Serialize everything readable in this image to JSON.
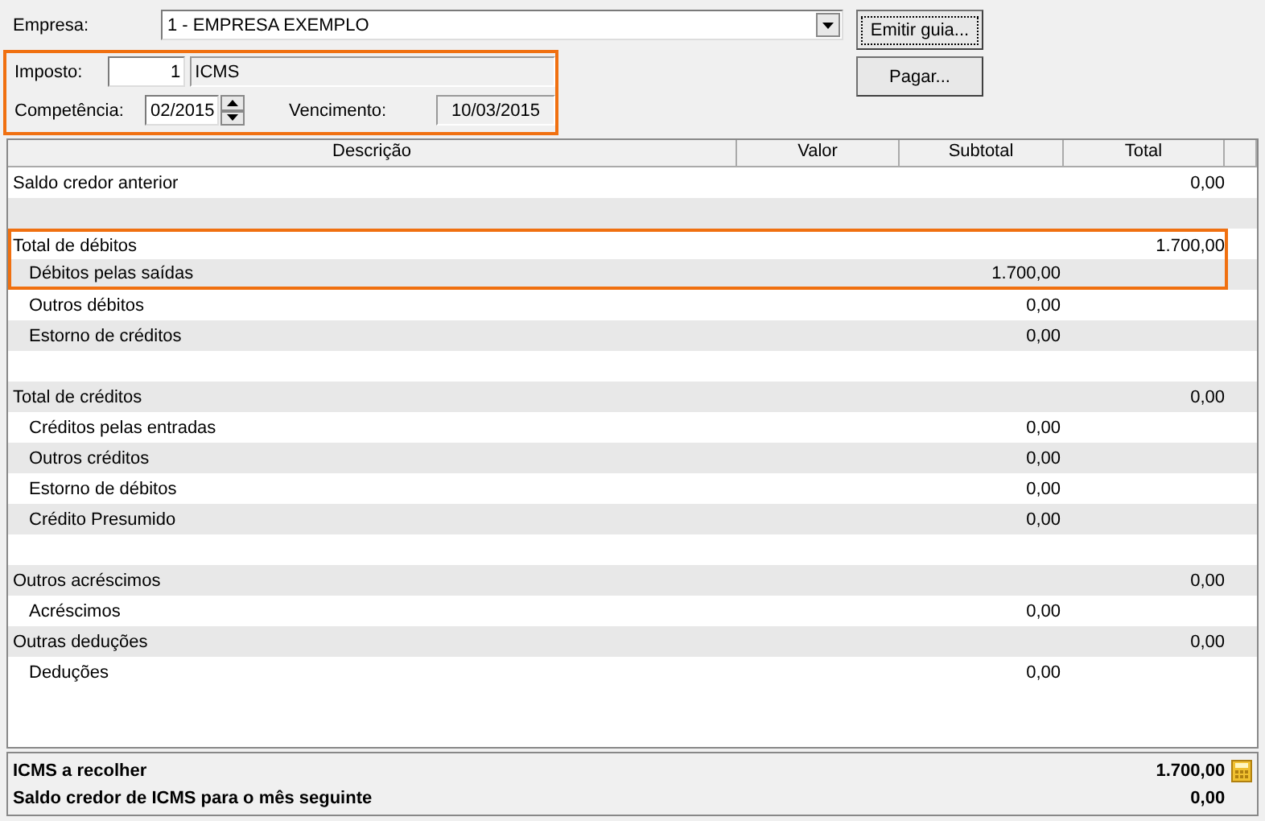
{
  "form": {
    "company_label": "Empresa:",
    "company_value": "1 - EMPRESA EXEMPLO",
    "highlighted": true,
    "tax_label": "Imposto:",
    "tax_code": "1",
    "tax_name": "ICMS",
    "period_label": "Competência:",
    "period_value": "02/2015",
    "due_label": "Vencimento:",
    "due_value": "10/03/2015"
  },
  "buttons": [
    {
      "label": "Emitir guia...",
      "focused": true
    },
    {
      "label": "Pagar...",
      "focused": false
    }
  ],
  "table": {
    "columns": [
      "Descrição",
      "Valor",
      "Subtotal",
      "Total"
    ],
    "groups": [
      {
        "kind": "item",
        "label": "Saldo credor anterior",
        "total": "0,00",
        "highlighted": false
      },
      {
        "kind": "spacer"
      },
      {
        "kind": "item",
        "label": "Total de débitos",
        "total": "1.700,00",
        "highlighted": true,
        "children": [
          {
            "label": "Débitos pelas saídas",
            "subtotal": "1.700,00",
            "highlighted": true
          },
          {
            "label": "Outros débitos",
            "subtotal": "0,00",
            "highlighted": false
          },
          {
            "label": "Estorno de créditos",
            "subtotal": "0,00",
            "highlighted": false
          }
        ]
      },
      {
        "kind": "spacer"
      },
      {
        "kind": "item",
        "label": "Total de créditos",
        "total": "0,00",
        "highlighted": false,
        "children": [
          {
            "label": "Créditos pelas entradas",
            "subtotal": "0,00",
            "highlighted": false
          },
          {
            "label": "Outros créditos",
            "subtotal": "0,00",
            "highlighted": false
          },
          {
            "label": "Estorno de débitos",
            "subtotal": "0,00",
            "highlighted": false
          },
          {
            "label": "Crédito Presumido",
            "subtotal": "0,00",
            "highlighted": false
          }
        ]
      },
      {
        "kind": "spacer"
      },
      {
        "kind": "item",
        "label": "Outros acréscimos",
        "total": "0,00",
        "highlighted": false,
        "children": [
          {
            "label": "Acréscimos",
            "subtotal": "0,00",
            "highlighted": false
          }
        ]
      },
      {
        "kind": "item",
        "label": "Outras deduções",
        "total": "0,00",
        "highlighted": false,
        "children": [
          {
            "label": "Deduções",
            "subtotal": "0,00",
            "highlighted": false
          }
        ]
      }
    ]
  },
  "summary": [
    {
      "label": "ICMS a recolher",
      "value": "1.700,00",
      "calculator": true
    },
    {
      "label": "Saldo credor de ICMS para o mês seguinte",
      "value": "0,00",
      "calculator": false
    }
  ]
}
